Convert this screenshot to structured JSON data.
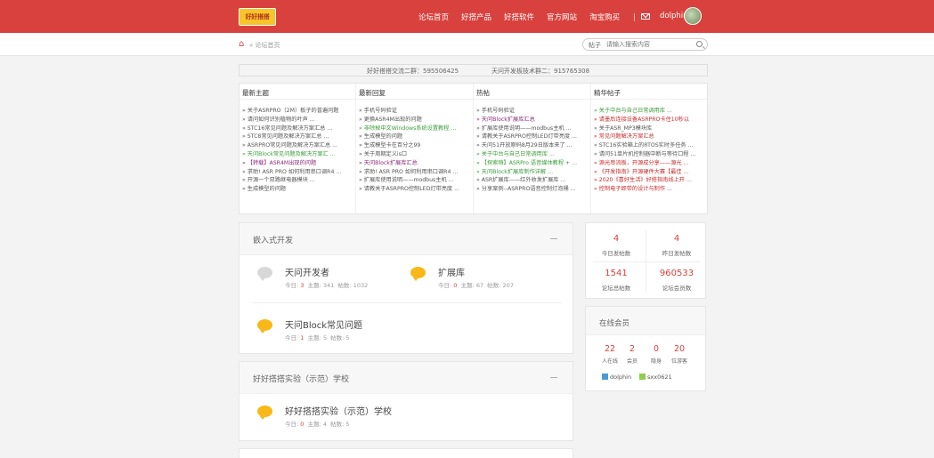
{
  "header": {
    "logo_text": "好好搭搭",
    "nav": [
      "论坛首页",
      "好搭产品",
      "好搭软件",
      "官方网站",
      "淘宝购买"
    ],
    "username": "dolphin"
  },
  "breadcrumb": {
    "current": "论坛首页"
  },
  "search": {
    "type": "帖子",
    "placeholder": "请输入搜索内容"
  },
  "notice": {
    "qq1": "好好搭搭交流二群：595506425",
    "qq2": "天问开发板技术群二：915765308"
  },
  "columns": [
    {
      "title": "最新主题",
      "items": [
        {
          "text": "» 关于ASRPRO（2M）板子的普遍问题",
          "color": "normal"
        },
        {
          "text": "» 请问如何识别植物的叶声 ...",
          "color": "normal"
        },
        {
          "text": "» STC16常见问题及解决方案汇总 ...",
          "color": "normal"
        },
        {
          "text": "» STC8常见问题及解决方案汇总 ...",
          "color": "normal"
        },
        {
          "text": "» ASRPRO常见问题及解决方案汇总 ...",
          "color": "normal"
        },
        {
          "text": "» 天问Block常见问题及解决方案汇 ...",
          "color": "green"
        },
        {
          "text": "» 【转载】ASR4M出现的问题",
          "color": "purple"
        },
        {
          "text": "» 求助! ASR PRO 如何利用串口调R4 ...",
          "color": "normal"
        },
        {
          "text": "» 开源一个双路继电器模块 ...",
          "color": "normal"
        },
        {
          "text": "» 生成模型的问题",
          "color": "normal"
        }
      ]
    },
    {
      "title": "最新回复",
      "items": [
        {
          "text": "» 手机号码验证",
          "color": "normal"
        },
        {
          "text": "» 更换ASR4M出现的问题",
          "color": "normal"
        },
        {
          "text": "» 非除掉中文Windows系统设置教程 ...",
          "color": "green"
        },
        {
          "text": "» 生成模型的问题",
          "color": "normal"
        },
        {
          "text": "» 生成模型卡在百分之99",
          "color": "normal"
        },
        {
          "text": "» 关于周期定义is口",
          "color": "normal"
        },
        {
          "text": "» 天问Block扩展库汇总",
          "color": "purple"
        },
        {
          "text": "» 求助! ASR PRO 如何利用串口调R4 ...",
          "color": "normal"
        },
        {
          "text": "» 扩展库使用说明——modbus主机 ...",
          "color": "normal"
        },
        {
          "text": "» 请教关于ASRPRO控制LED灯带亮度 ...",
          "color": "normal"
        }
      ]
    },
    {
      "title": "热帖",
      "items": [
        {
          "text": "» 手机号码验证",
          "color": "normal"
        },
        {
          "text": "» 天问Block扩展库汇总",
          "color": "purple"
        },
        {
          "text": "» 扩展库使用说明——modbus主机 ...",
          "color": "normal"
        },
        {
          "text": "» 请教关于ASRPRO控制LED灯带亮度 ...",
          "color": "normal"
        },
        {
          "text": "» 天问51开放原码8月29日版本来了 ...",
          "color": "normal"
        },
        {
          "text": "» 关于中台与自己日常调用库 ...",
          "color": "green"
        },
        {
          "text": "» 【探索嗨】ASRPro 语音媒体教程 + ...",
          "color": "green"
        },
        {
          "text": "» 天问Block扩展库制作详解 ...",
          "color": "green"
        },
        {
          "text": "» ASR扩展库——红外收发扩展库 ...",
          "color": "normal"
        },
        {
          "text": "» 分享案例--ASRPRO语音控制灯泡桶 ...",
          "color": "normal"
        }
      ]
    },
    {
      "title": "精华帖子",
      "items": [
        {
          "text": "» 关于中台与自己日常调用库 ...",
          "color": "green"
        },
        {
          "text": "» 请墨后连接设备ASRPRO卡住10秒以",
          "color": "red"
        },
        {
          "text": "» 关于ASR_MP3模块库",
          "color": "normal"
        },
        {
          "text": "» 常见问题解决方案汇总",
          "color": "red"
        },
        {
          "text": "» STC16实验箱上的RTOS实时多任务 ...",
          "color": "normal"
        },
        {
          "text": "» 请问51单片机控制器中断与等待口程 ...",
          "color": "normal"
        },
        {
          "text": "» 源光串流板，开源成分享——源光 ...",
          "color": "red"
        },
        {
          "text": "» 《开发指南》开源硬件大赛【最佳 ...",
          "color": "red"
        },
        {
          "text": "» 2020《喜好生活》好搭指南线上开 ...",
          "color": "red"
        },
        {
          "text": "» 控制电子即带的设计与制作 ...",
          "color": "red"
        }
      ]
    }
  ],
  "sections": [
    {
      "title": "嵌入式开发",
      "forums": [
        {
          "name": "天问开发者",
          "today_label": "今日:",
          "today": "3",
          "topics_label": "主题:",
          "topics": "341",
          "posts_label": "帖数:",
          "posts": "1032",
          "icon": "gray"
        },
        {
          "name": "扩展库",
          "today_label": "今日:",
          "today": "0",
          "topics_label": "主题:",
          "topics": "67",
          "posts_label": "帖数:",
          "posts": "207",
          "icon": "gold"
        },
        {
          "name": "天问Block常见问题",
          "today_label": "今日:",
          "today": "1",
          "topics_label": "主题:",
          "topics": "5",
          "posts_label": "帖数:",
          "posts": "5",
          "icon": "gold"
        }
      ]
    },
    {
      "title": "好好搭搭实验（示范）学校",
      "forums": [
        {
          "name": "好好搭搭实验（示范）学校",
          "today_label": "今日:",
          "today": "0",
          "topics_label": "主题:",
          "topics": "4",
          "posts_label": "帖数:",
          "posts": "5",
          "icon": "gold"
        }
      ]
    }
  ],
  "stats": {
    "today_posts": "4",
    "today_posts_label": "今日发帖数",
    "yesterday_posts": "4",
    "yesterday_posts_label": "昨日发帖数",
    "total_posts": "1541",
    "total_posts_label": "论坛总帖数",
    "members": "960533",
    "members_label": "论坛会员数"
  },
  "online": {
    "title": "在线会员",
    "counts": [
      {
        "num": "22",
        "label": "人在线"
      },
      {
        "num": "2",
        "label": "会员"
      },
      {
        "num": "0",
        "label": "隐身"
      },
      {
        "num": "20",
        "label": "位游客"
      }
    ],
    "members": [
      "dolphin",
      "sxx0621"
    ]
  }
}
